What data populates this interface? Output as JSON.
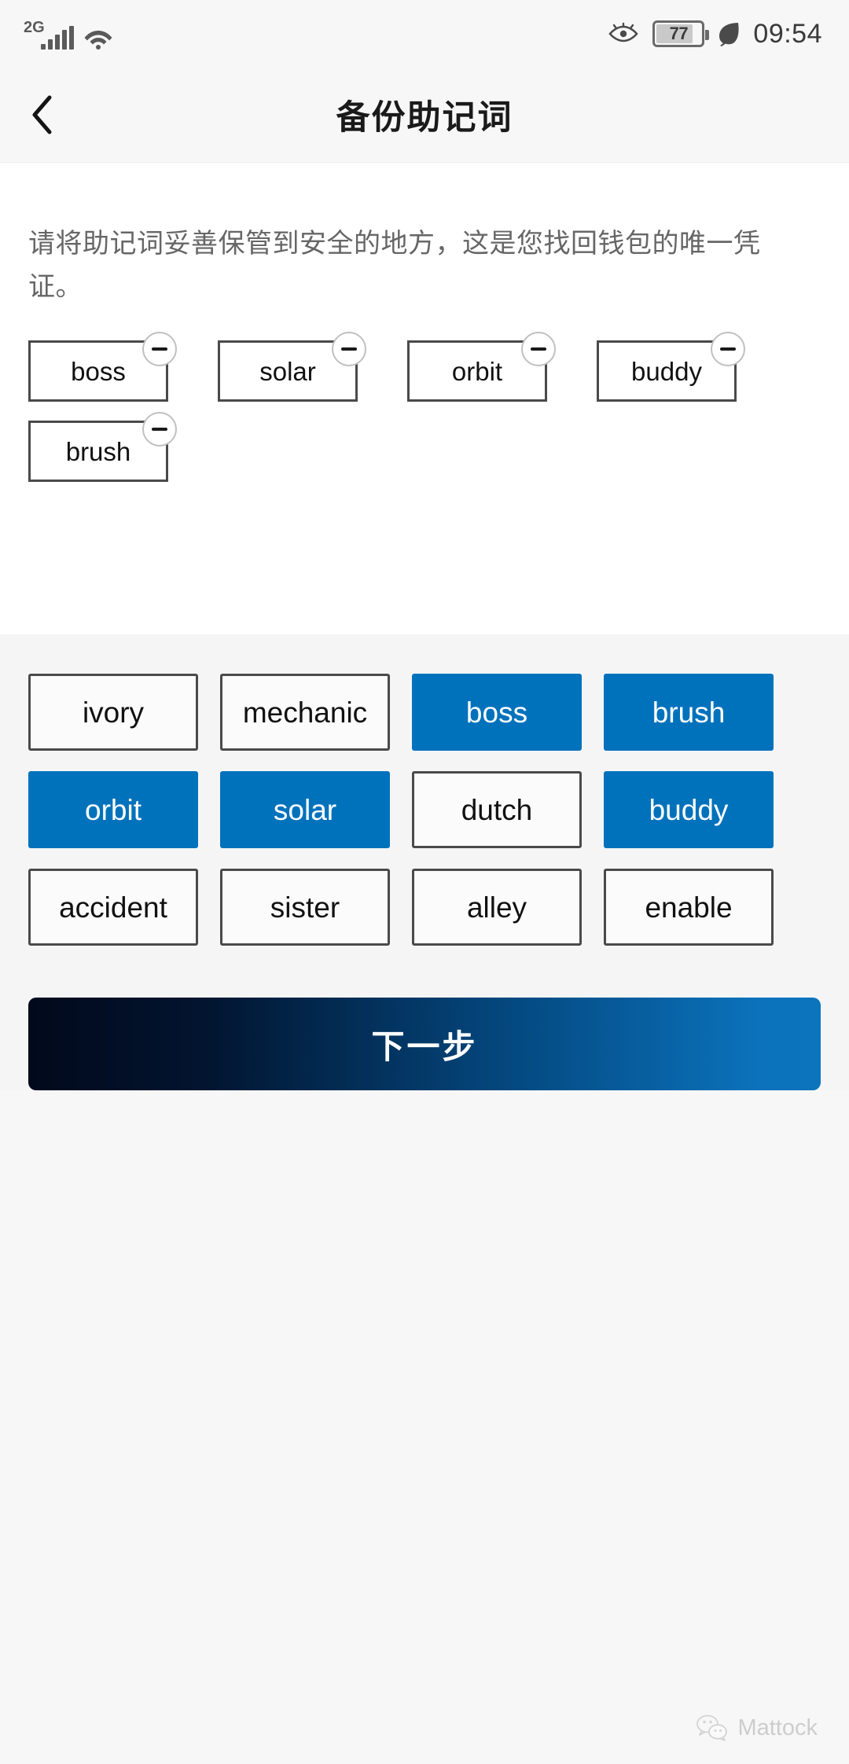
{
  "status_bar": {
    "network_type": "2G",
    "signal_icon": "signal-bars-icon",
    "wifi_icon": "wifi-icon",
    "eye_comfort_icon": "eye-icon",
    "battery_level": "77",
    "battery_icon": "battery-icon",
    "power_saving_icon": "leaf-icon",
    "time": "09:54"
  },
  "header": {
    "back_icon": "chevron-left-icon",
    "title": "备份助记词"
  },
  "main": {
    "instruction": "请将助记词妥善保管到安全的地方，这是您找回钱包的唯一凭证。",
    "selected_words": [
      {
        "label": "boss",
        "remove_icon": "minus-circle-icon"
      },
      {
        "label": "solar",
        "remove_icon": "minus-circle-icon"
      },
      {
        "label": "orbit",
        "remove_icon": "minus-circle-icon"
      },
      {
        "label": "buddy",
        "remove_icon": "minus-circle-icon"
      },
      {
        "label": "brush",
        "remove_icon": "minus-circle-icon"
      }
    ],
    "word_pool": [
      {
        "label": "ivory",
        "selected": false
      },
      {
        "label": "mechanic",
        "selected": false
      },
      {
        "label": "boss",
        "selected": true
      },
      {
        "label": "brush",
        "selected": true
      },
      {
        "label": "orbit",
        "selected": true
      },
      {
        "label": "solar",
        "selected": true
      },
      {
        "label": "dutch",
        "selected": false
      },
      {
        "label": "buddy",
        "selected": true
      },
      {
        "label": "accident",
        "selected": false
      },
      {
        "label": "sister",
        "selected": false
      },
      {
        "label": "alley",
        "selected": false
      },
      {
        "label": "enable",
        "selected": false
      }
    ],
    "next_button": "下一步"
  },
  "footer": {
    "wechat_icon": "wechat-icon",
    "account_name": "Mattock"
  },
  "colors": {
    "accent_blue": "#0072bc",
    "cta_gradient_start": "#02091c",
    "cta_gradient_end": "#0b74bd",
    "panel_white": "#ffffff",
    "panel_grey": "#f5f5f5",
    "border_dark": "#4a4a4a"
  }
}
